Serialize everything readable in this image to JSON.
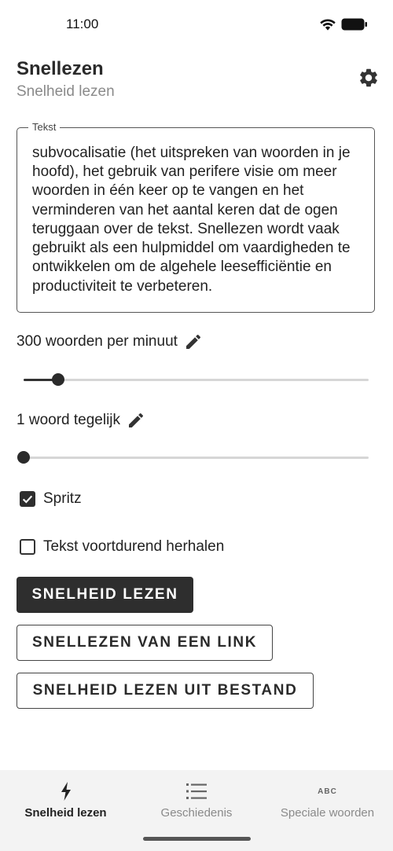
{
  "status": {
    "time": "11:00"
  },
  "header": {
    "title": "Snellezen",
    "subtitle": "Snelheid lezen"
  },
  "text_field": {
    "label": "Tekst",
    "value": "subvocalisatie (het uitspreken van woorden in je hoofd), het gebruik van perifere visie om meer woorden in één keer op te vangen en het verminderen van het aantal keren dat de ogen teruggaan over de tekst. Snellezen wordt vaak gebruikt als een hulpmiddel om vaardigheden te ontwikkelen om de algehele leesefficiëntie en productiviteit te verbeteren."
  },
  "speed": {
    "label": "300 woorden per minuut",
    "slider_fraction": 0.1
  },
  "words_at_once": {
    "label": "1 woord tegelijk",
    "slider_fraction": 0.0
  },
  "options": {
    "spritz": {
      "label": "Spritz",
      "checked": true
    },
    "repeat": {
      "label": "Tekst voortdurend herhalen",
      "checked": false
    }
  },
  "buttons": {
    "speed_read": "SNELHEID LEZEN",
    "read_link": "SNELLEZEN VAN EEN LINK",
    "read_file": "SNELHEID LEZEN UIT BESTAND"
  },
  "bottom_nav": {
    "items": [
      {
        "label": "Snelheid lezen",
        "icon": "bolt-icon",
        "active": true
      },
      {
        "label": "Geschiedenis",
        "icon": "list-icon",
        "active": false
      },
      {
        "label": "Speciale woorden",
        "icon": "abc-icon",
        "icon_text": "ABC",
        "active": false
      }
    ]
  },
  "colors": {
    "primary": "#2e2e2e",
    "accent_track": "#d6d6d6",
    "nav_background": "#f3f3f3"
  }
}
